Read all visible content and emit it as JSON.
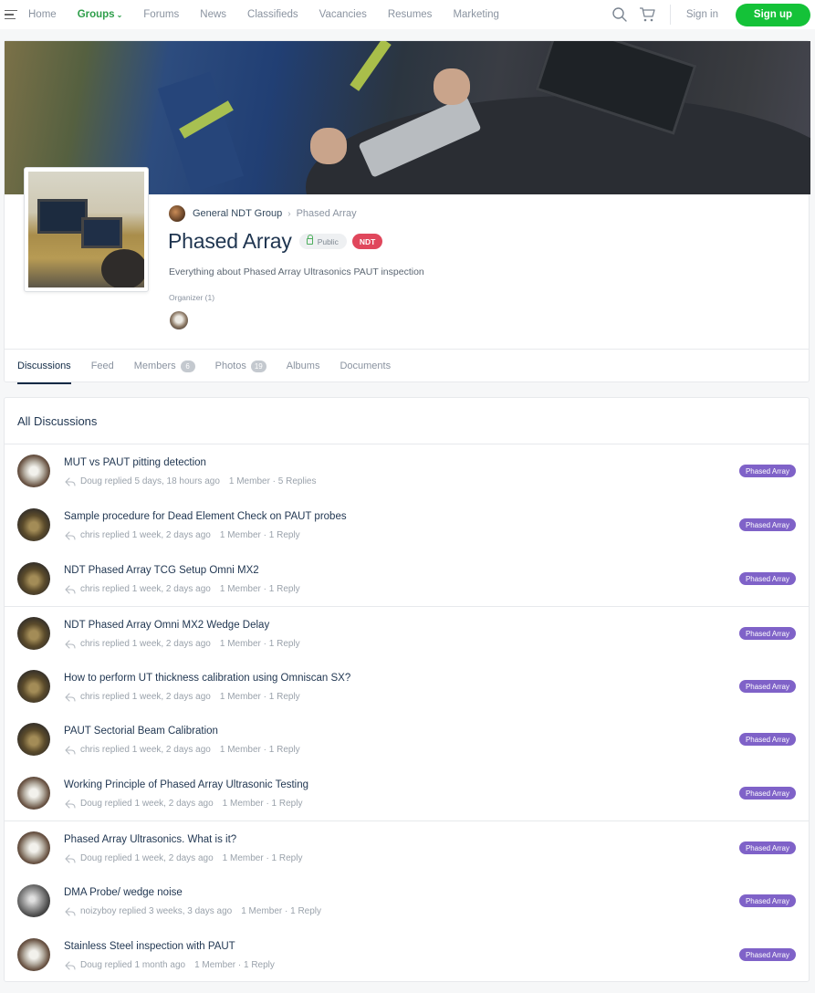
{
  "nav": {
    "links": [
      {
        "label": "Home",
        "active": false
      },
      {
        "label": "Groups",
        "active": true,
        "dropdown": true
      },
      {
        "label": "Forums",
        "active": false
      },
      {
        "label": "News",
        "active": false
      },
      {
        "label": "Classifieds",
        "active": false
      },
      {
        "label": "Vacancies",
        "active": false
      },
      {
        "label": "Resumes",
        "active": false
      },
      {
        "label": "Marketing",
        "active": false
      }
    ],
    "signin_label": "Sign in",
    "signup_label": "Sign up"
  },
  "group": {
    "parent": "General NDT Group",
    "current": "Phased Array",
    "title": "Phased Array",
    "privacy": "Public",
    "type_badge": "NDT",
    "description": "Everything about Phased Array Ultrasonics PAUT inspection",
    "organizer_label": "Organizer (1)"
  },
  "tabs": [
    {
      "label": "Discussions",
      "active": true
    },
    {
      "label": "Feed"
    },
    {
      "label": "Members",
      "count": "6"
    },
    {
      "label": "Photos",
      "count": "19"
    },
    {
      "label": "Albums"
    },
    {
      "label": "Documents"
    }
  ],
  "discussions": {
    "header": "All Discussions",
    "items": [
      {
        "title": "MUT vs PAUT pitting detection",
        "replied": "Doug replied 5 days, 18 hours ago",
        "stats": "1 Member · 5 Replies",
        "tag": "Phased Array",
        "avatar": "doug"
      },
      {
        "title": "Sample procedure for Dead Element Check on PAUT probes",
        "replied": "chris replied 1 week, 2 days ago",
        "stats": "1 Member · 1 Reply",
        "tag": "Phased Array",
        "avatar": "chris"
      },
      {
        "title": "NDT Phased Array TCG Setup Omni MX2",
        "replied": "chris replied 1 week, 2 days ago",
        "stats": "1 Member · 1 Reply",
        "tag": "Phased Array",
        "avatar": "chris"
      },
      {
        "title": "NDT Phased Array Omni MX2 Wedge Delay",
        "replied": "chris replied 1 week, 2 days ago",
        "stats": "1 Member · 1 Reply",
        "tag": "Phased Array",
        "avatar": "chris"
      },
      {
        "title": "How to perform UT thickness calibration using Omniscan SX?",
        "replied": "chris replied 1 week, 2 days ago",
        "stats": "1 Member · 1 Reply",
        "tag": "Phased Array",
        "avatar": "chris"
      },
      {
        "title": "PAUT Sectorial Beam Calibration",
        "replied": "chris replied 1 week, 2 days ago",
        "stats": "1 Member · 1 Reply",
        "tag": "Phased Array",
        "avatar": "chris"
      },
      {
        "title": "Working Principle of Phased Array Ultrasonic Testing",
        "replied": "Doug replied 1 week, 2 days ago",
        "stats": "1 Member · 1 Reply",
        "tag": "Phased Array",
        "avatar": "doug"
      },
      {
        "title": "Phased Array Ultrasonics. What is it?",
        "replied": "Doug replied 1 week, 2 days ago",
        "stats": "1 Member · 1 Reply",
        "tag": "Phased Array",
        "avatar": "doug"
      },
      {
        "title": "DMA Probe/ wedge noise",
        "replied": "noizyboy replied 3 weeks, 3 days ago",
        "stats": "1 Member · 1 Reply",
        "tag": "Phased Array",
        "avatar": "noizy"
      },
      {
        "title": "Stainless Steel inspection with PAUT",
        "replied": "Doug replied 1 month ago",
        "stats": "1 Member · 1 Reply",
        "tag": "Phased Array",
        "avatar": "doug"
      }
    ]
  },
  "colors": {
    "accent": "#14c238",
    "tag": "#7f62c8",
    "ndt_badge": "#e0475c"
  }
}
